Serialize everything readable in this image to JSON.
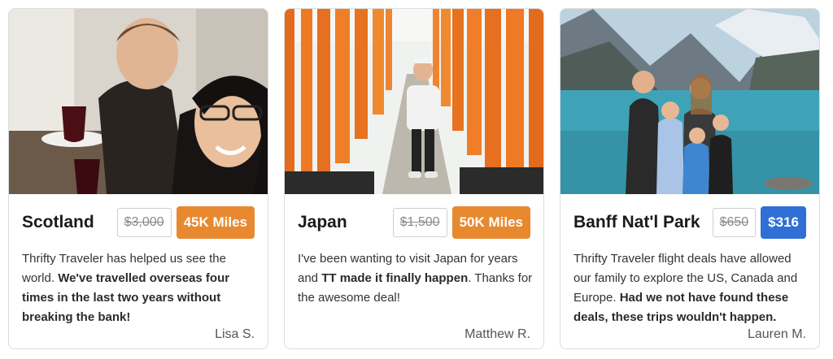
{
  "cards": [
    {
      "destination": "Scotland",
      "old_price": "$3,000",
      "new_price": "45K Miles",
      "badge_color": "#e8892f",
      "quote_parts": [
        "Thrifty Traveler has helped us see the world. ",
        "We've travelled overseas four times in the last two years without breaking the bank!",
        ""
      ],
      "author": "Lisa S."
    },
    {
      "destination": "Japan",
      "old_price": "$1,500",
      "new_price": "50K Miles",
      "badge_color": "#e8892f",
      "quote_parts": [
        "I've been wanting to visit Japan for years and ",
        "TT made it finally happen",
        ". Thanks for the awesome deal!"
      ],
      "author": "Matthew R."
    },
    {
      "destination": "Banff Nat'l Park",
      "old_price": "$650",
      "new_price": "$316",
      "badge_color": "#2f6fd6",
      "quote_parts": [
        "Thrifty Traveler flight deals have allowed our family to explore the US, Canada and Europe. ",
        "Had we not have found these deals, these trips wouldn't happen.",
        ""
      ],
      "author": "Lauren M."
    }
  ]
}
